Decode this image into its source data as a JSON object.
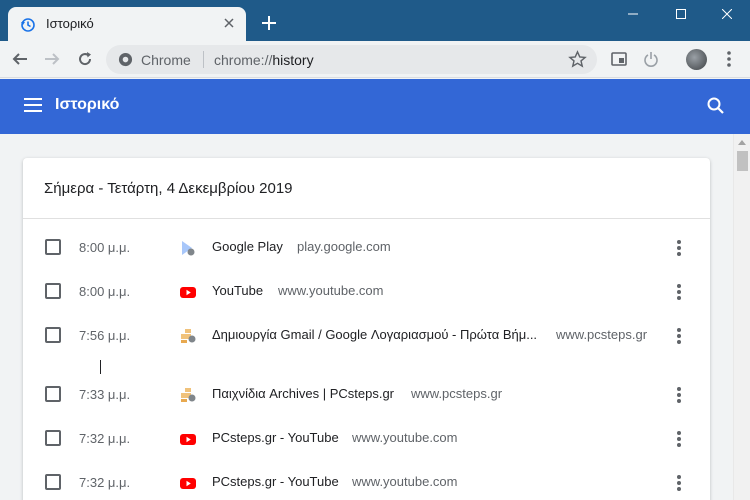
{
  "window": {
    "tab_title": "Ιστορικό",
    "controls": {
      "minimize": "minimize",
      "maximize": "maximize",
      "close": "close"
    }
  },
  "toolbar": {
    "chip": "Chrome",
    "url_scheme": "chrome://",
    "url_host": "history"
  },
  "header": {
    "title": "Ιστορικό"
  },
  "history": {
    "date_heading": "Σήμερα - Τετάρτη, 4 Δεκεμβρίου 2019",
    "entries": [
      {
        "time": "8:00 μ.μ.",
        "title": "Google Play",
        "domain": "play.google.com",
        "favicon": "google-play"
      },
      {
        "time": "8:00 μ.μ.",
        "title": "YouTube",
        "domain": "www.youtube.com",
        "favicon": "youtube"
      },
      {
        "time": "7:56 μ.μ.",
        "title": "Δημιουργία Gmail / Google Λογαριασμού - Πρώτα Βήμ...",
        "domain": "www.pcsteps.gr",
        "favicon": "pcsteps"
      },
      {
        "time": "7:33 μ.μ.",
        "title": "Παιχνίδια Archives | PCsteps.gr",
        "domain": "www.pcsteps.gr",
        "favicon": "pcsteps"
      },
      {
        "time": "7:32 μ.μ.",
        "title": "PCsteps.gr - YouTube",
        "domain": "www.youtube.com",
        "favicon": "youtube"
      },
      {
        "time": "7:32 μ.μ.",
        "title": "PCsteps.gr - YouTube",
        "domain": "www.youtube.com",
        "favicon": "youtube"
      }
    ]
  },
  "colors": {
    "title_bar": "#1f5a89",
    "header": "#3367d6",
    "youtube_red": "#ff0000"
  }
}
